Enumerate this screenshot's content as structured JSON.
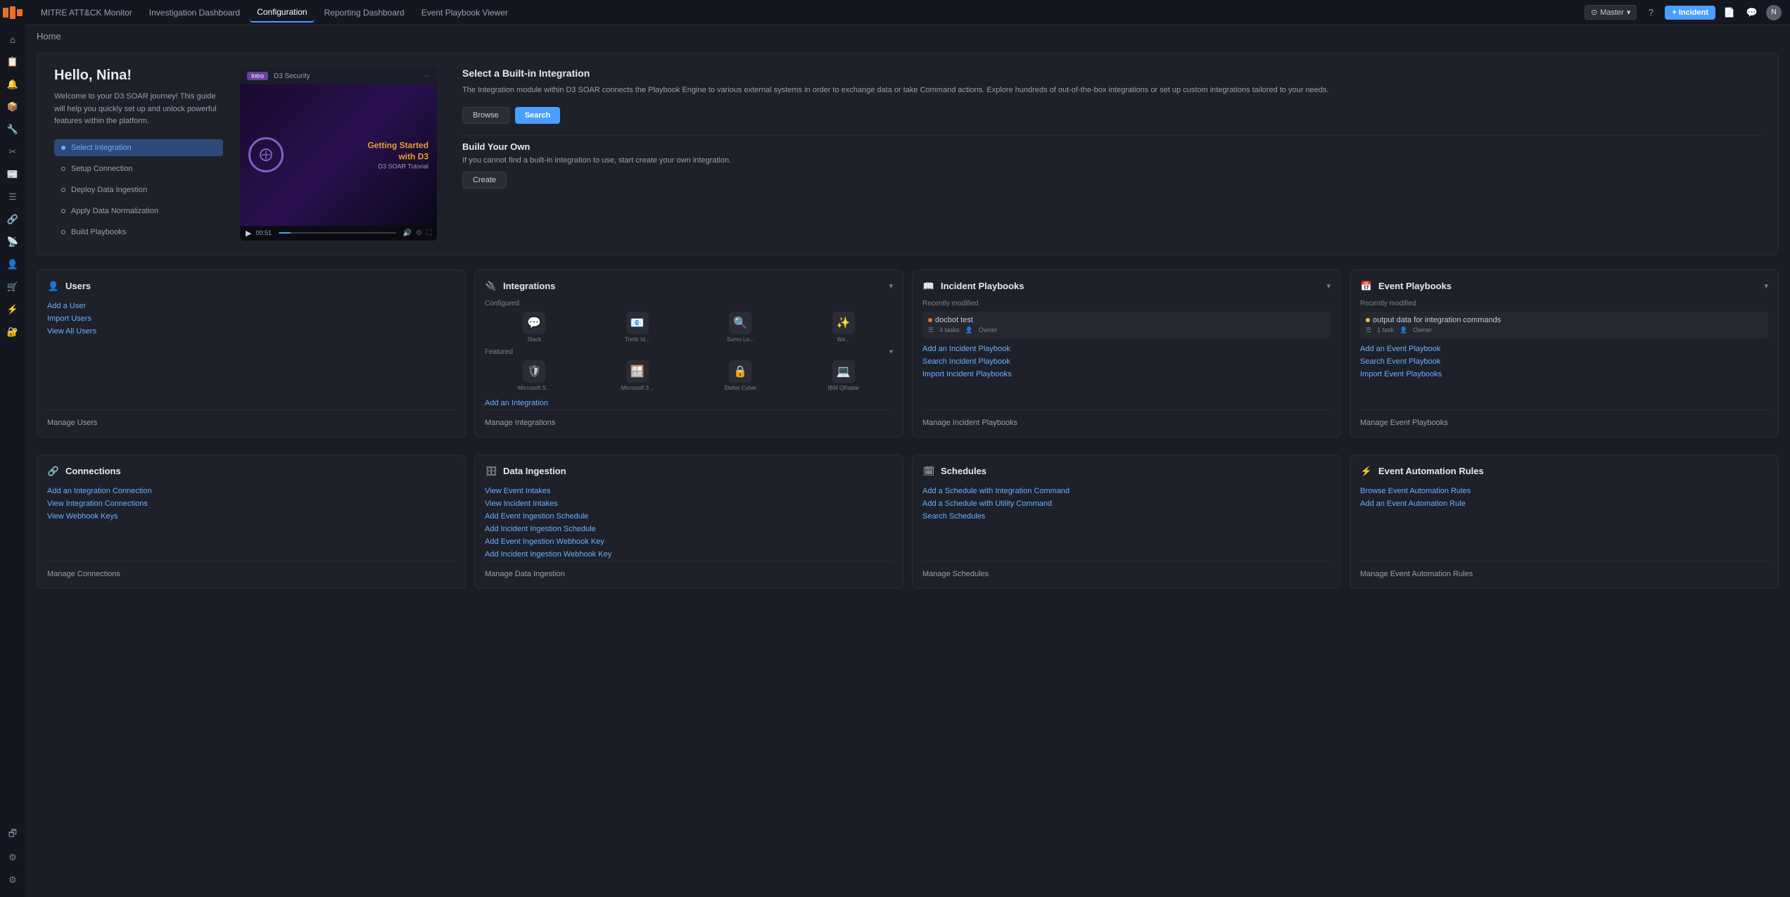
{
  "app": {
    "logo": "D3",
    "nav_items": [
      {
        "id": "mitre",
        "label": "MITRE ATT&CK Monitor",
        "active": false
      },
      {
        "id": "investigation",
        "label": "Investigation Dashboard",
        "active": false
      },
      {
        "id": "configuration",
        "label": "Configuration",
        "active": true
      },
      {
        "id": "reporting",
        "label": "Reporting Dashboard",
        "active": false
      },
      {
        "id": "playbook_viewer",
        "label": "Event Playbook Viewer",
        "active": false
      }
    ],
    "master_label": "Master",
    "incident_label": "+ Incident",
    "breadcrumb": "Home"
  },
  "sidebar_icons": [
    "⌂",
    "📋",
    "🔔",
    "📦",
    "🔧",
    "✂",
    "📰",
    "☰",
    "🔗",
    "📡",
    "👤",
    "🛒",
    "⚡",
    "🔐"
  ],
  "sidebar_bottom_icons": [
    "🗗",
    "⚙",
    "⚙"
  ],
  "welcome": {
    "title": "Hello, Nina!",
    "description": "Welcome to your D3 SOAR journey! This guide will help you quickly set up and unlock powerful features within the platform.",
    "steps": [
      {
        "id": "select-integration",
        "label": "Select Integration",
        "active": true
      },
      {
        "id": "setup-connection",
        "label": "Setup Connection",
        "active": false
      },
      {
        "id": "deploy-data-ingestion",
        "label": "Deploy Data Ingestion",
        "active": false
      },
      {
        "id": "apply-normalization",
        "label": "Apply Data Normalization",
        "active": false
      },
      {
        "id": "build-playbooks",
        "label": "Build Playbooks",
        "active": false
      }
    ],
    "video": {
      "badge": "Intro",
      "channel": "D3 Security",
      "title": "Getting Started\nwith D3",
      "subtitle": "D3 SOAR Tutorial",
      "timestamp": "00:51"
    },
    "integration_panel": {
      "title": "Select a Built-in Integration",
      "description": "The Integration module within D3 SOAR connects the Playbook Engine to various external systems in order to exchange data or take Command actions. Explore hundreds of out-of-the-box integrations or set up custom integrations tailored to your needs.",
      "browse_label": "Browse",
      "search_label": "Search",
      "build_title": "Build Your Own",
      "build_description": "If you cannot find a built-in integration to use, start create your own integration.",
      "create_label": "Create"
    }
  },
  "cards": {
    "users": {
      "title": "Users",
      "icon": "👤",
      "links": [
        "Add a User",
        "Import Users",
        "View All Users"
      ],
      "manage": "Manage Users"
    },
    "integrations": {
      "title": "Integrations",
      "icon": "🔌",
      "configured_label": "Configured",
      "featured_label": "Featured",
      "icons_configured": [
        {
          "label": "Slack",
          "emoji": "💬"
        },
        {
          "label": "Trellir Id...",
          "emoji": "📧"
        },
        {
          "label": "Sumo Lo...",
          "emoji": "🔍"
        },
        {
          "label": "Wir...",
          "emoji": "✨"
        }
      ],
      "icons_featured": [
        {
          "label": "Microsoft S...",
          "emoji": "🛡"
        },
        {
          "label": "Microsoft 3...",
          "emoji": "🪟"
        },
        {
          "label": "Stellar Cyber",
          "emoji": "🔒"
        },
        {
          "label": "IBM QRadar",
          "emoji": "💻"
        }
      ],
      "links": [
        "Add an Integration",
        "Manage Integrations"
      ],
      "manage": "Manage Integrations"
    },
    "incident_playbooks": {
      "title": "Incident Playbooks",
      "icon": "📖",
      "recently_label": "Recently modified",
      "recent_item": {
        "name": "docbot test",
        "tasks": "4 tasks",
        "owner": "Owner"
      },
      "links": [
        "Add an Incident Playbook",
        "Search Incident Playbook",
        "Import Incident Playbooks"
      ],
      "manage": "Manage Incident Playbooks"
    },
    "event_playbooks": {
      "title": "Event Playbooks",
      "icon": "📅",
      "recently_label": "Recently modified",
      "recent_item": {
        "name": "output data for integration commands",
        "tasks": "1 task",
        "owner": "Owner"
      },
      "links": [
        "Add an Event Playbook",
        "Search Event Playbook",
        "Import Event Playbooks"
      ],
      "manage": "Manage Event Playbooks"
    },
    "connections": {
      "title": "Connections",
      "icon": "🔗",
      "links": [
        "Add an Integration Connection",
        "View Integration Connections",
        "View Webhook Keys"
      ],
      "manage": "Manage Connections"
    },
    "data_ingestion": {
      "title": "Data Ingestion",
      "icon": "🗄",
      "links": [
        "View Event Intakes",
        "View Incident Intakes",
        "Add Event Ingestion Schedule",
        "Add Incident Ingestion Schedule",
        "Add Event Ingestion Webhook Key",
        "Add Incident Ingestion Webhook Key"
      ],
      "manage": "Manage Data Ingestion"
    },
    "schedules": {
      "title": "Schedules",
      "icon": "🗓",
      "links": [
        "Add a Schedule with Integration Command",
        "Add a Schedule with Utility Command",
        "Search Schedules"
      ],
      "manage": "Manage Schedules"
    },
    "event_automation": {
      "title": "Event Automation Rules",
      "icon": "⚡",
      "links": [
        "Browse Event Automation Rules",
        "Add an Event Automation Rule"
      ],
      "manage": "Manage Event Automation Rules"
    }
  }
}
